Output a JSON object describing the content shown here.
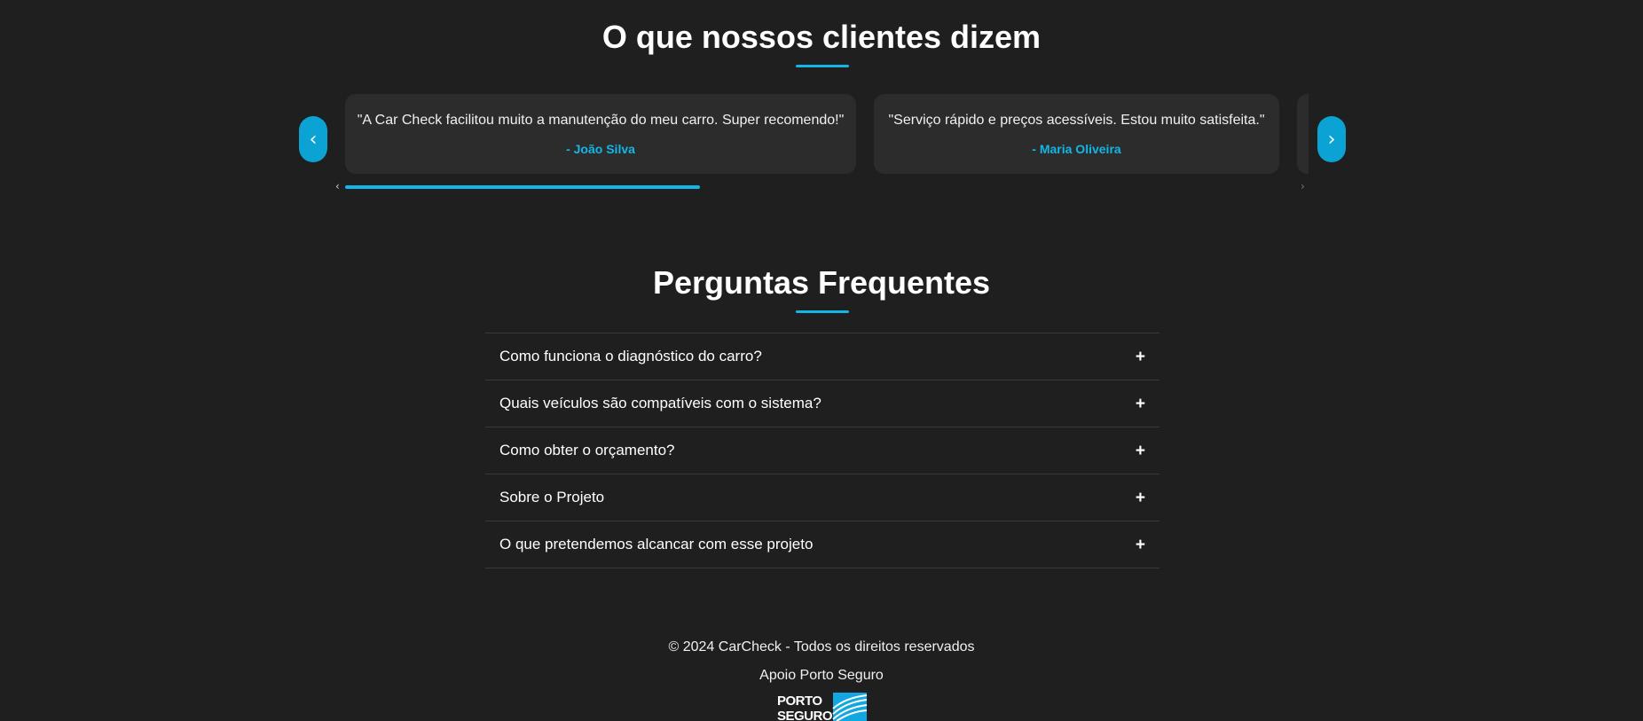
{
  "testimonials": {
    "title": "O que nossos clientes dizem",
    "prev_label": "‹",
    "next_label": "›",
    "items": [
      {
        "quote": "\"A Car Check facilitou muito a manutenção do meu carro. Super recomendo!\"",
        "author": "- João Silva"
      },
      {
        "quote": "\"Serviço rápido e preços acessíveis. Estou muito satisfeita.\"",
        "author": "- Maria Oliveira"
      }
    ],
    "scroll_position": 0.37
  },
  "faq": {
    "title": "Perguntas Frequentes",
    "items": [
      {
        "question": "Como funciona o diagnóstico do carro?",
        "icon": "+"
      },
      {
        "question": "Quais veículos são compatíveis com o sistema?",
        "icon": "+"
      },
      {
        "question": "Como obter o orçamento?",
        "icon": "+"
      },
      {
        "question": "Sobre o Projeto",
        "icon": "+"
      },
      {
        "question": "O que pretendemos alcancar com esse projeto",
        "icon": "+"
      }
    ]
  },
  "footer": {
    "copyright": "© 2024 CarCheck - Todos os direitos reservados",
    "support": "Apoio Porto Seguro",
    "logo": {
      "line1": "PORTO",
      "line2": "SEGURO"
    }
  },
  "colors": {
    "background": "#1f1f1f",
    "card": "#2c2c2c",
    "accent": "#12b7e8",
    "button": "#0aa3d3"
  }
}
